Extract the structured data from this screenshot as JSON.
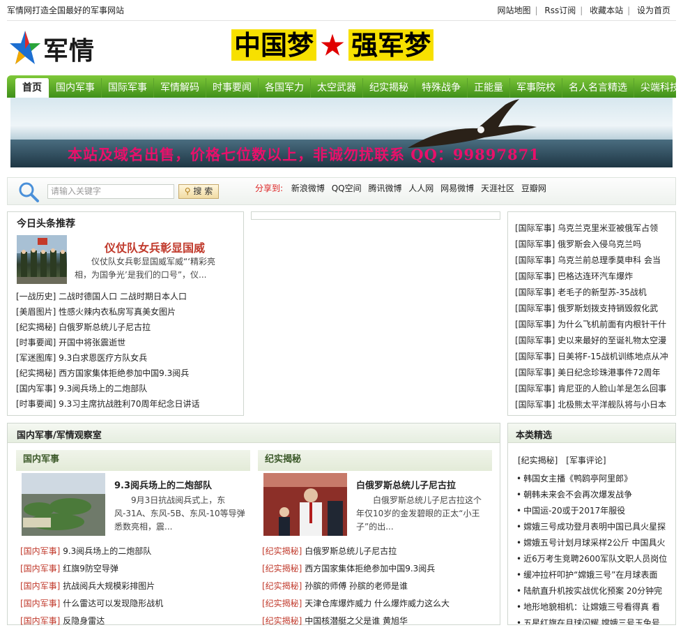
{
  "topbar": {
    "tagline": "军情网打造全国最好的军事网站",
    "links": [
      "网站地图",
      "Rss订阅",
      "收藏本站",
      "设为首页"
    ]
  },
  "header": {
    "logo_text": "军情网",
    "slogan_left": "中国梦",
    "slogan_star": "★",
    "slogan_right": "强军梦"
  },
  "nav": {
    "items": [
      "首页",
      "国内军事",
      "国际军事",
      "军情解码",
      "时事要闻",
      "各国军力",
      "太空武器",
      "纪实揭秘",
      "特殊战争",
      "正能量",
      "军事院校",
      "名人名言精选",
      "尖端科技"
    ]
  },
  "banner": {
    "text": "本站及域名出售，价格七位数以上，非诚勿扰联系 QQ：99897871"
  },
  "search": {
    "placeholder": "请输入关键字",
    "button": "搜 索",
    "share_label": "分享到:",
    "share_links": [
      "新浪微博",
      "QQ空间",
      "腾讯微博",
      "人人网",
      "网易微博",
      "天涯社区",
      "豆瓣网"
    ]
  },
  "top_news": {
    "title": "今日头条推荐",
    "headline": "仪仗队女兵彰显国威",
    "desc": "仪仗队女兵彰显国威军威“‘精彩亮相，为国争光’是我们的口号”，仪...",
    "items": [
      "[一战历史] 二战时德国人口 二战时期日本人口",
      "[美眉图片] 性感火辣内衣私房写真美女图片",
      "[纪实揭秘] 白俄罗斯总统儿子尼古拉",
      "[时事要闻] 开国中将张震逝世",
      "[军迷图库] 9.3白求恩医疗方队女兵",
      "[纪实揭秘] 西方国家集体拒绝参加中国9.3阅兵",
      "[国内军事] 9.3阅兵场上的二炮部队",
      "[时事要闻] 9.3习主席抗战胜利70周年纪念日讲话"
    ]
  },
  "intl_list": {
    "items": [
      "[国际军事] 乌克兰克里米亚被俄军占领",
      "[国际军事] 俄罗斯会入侵乌克兰吗",
      "[国际军事] 乌克兰前总理季莫申科 会当",
      "[国际军事] 巴格达连环汽车爆炸",
      "[国际军事] 老毛子的新型苏-35战机",
      "[国际军事] 俄罗斯划拨支持销毁叙化武",
      "[国际军事] 为什么飞机前面有内根针干什",
      "[国际军事] 史以来最好的至诞礼物太空漫",
      "[国际军事] 日美将F-15战机训练地点从冲",
      "[国际军事] 美日纪念珍珠港事件72周年",
      "[国际军事] 肯尼亚的人脸山羊是怎么回事",
      "[国际军事] 北极熊太平洋舰队将与小日本"
    ]
  },
  "section": {
    "title": "国内军事/军情观察室",
    "col1": {
      "title": "国内军事",
      "feature_title": "9.3阅兵场上的二炮部队",
      "feature_desc": "9月3日抗战阅兵式上，东风-31A、东风-5B、东风-10等导弹悉数亮相，震...",
      "items": [
        {
          "cat": "[国内军事]",
          "text": "9.3阅兵场上的二炮部队"
        },
        {
          "cat": "[国内军事]",
          "text": "红旗9防空导弹"
        },
        {
          "cat": "[国内军事]",
          "text": "抗战阅兵大规模彩排图片"
        },
        {
          "cat": "[国内军事]",
          "text": "什么雷达可以发现隐形战机"
        },
        {
          "cat": "[国内军事]",
          "text": "反隐身雷达"
        }
      ]
    },
    "col2": {
      "title": "纪实揭秘",
      "feature_title": "白俄罗斯总统儿子尼古拉",
      "feature_desc": "白俄罗斯总统儿子尼古拉这个年仅10岁的金发碧眼的正太“小王子”的出...",
      "items": [
        {
          "cat": "[纪实揭秘]",
          "text": "白俄罗斯总统儿子尼古拉"
        },
        {
          "cat": "[纪实揭秘]",
          "text": "西方国家集体拒绝参加中国9.3阅兵"
        },
        {
          "cat": "[纪实揭秘]",
          "text": "孙膑的师傅 孙膑的老师是谁"
        },
        {
          "cat": "[纪实揭秘]",
          "text": "天津仓库爆炸威力 什么爆炸威力这么大"
        },
        {
          "cat": "[纪实揭秘]",
          "text": "中国核潜艇之父是谁 黄旭华"
        }
      ]
    }
  },
  "category_picks": {
    "title": "本类精选",
    "tags": [
      "[纪实揭秘]",
      "[军事评论]"
    ],
    "items": [
      "韩国女主播《鸭鸥亭阿里郎》",
      "朝韩未来会不会再次爆发战争",
      "中国运-20或于2017年服役",
      "嫦娥三号成功登月表明中国已具火星探",
      "嫦娥五号计划月球采样2公斤 中国具火",
      "近6万考生竞聘2600军队文职人员岗位",
      "缓冲拉杆叩护“嫦娥三号”在月球表面",
      "陆航直升机按实战优化预案 20分钟完",
      "地形地貌相机：让嫦娥三号看得真 看",
      "五星红旗在月球闪耀 嫦娥三号玉兔号"
    ]
  },
  "colors": {
    "nav_green": "#3f8f1a",
    "accent_red": "#c0392b",
    "banner_pink": "#e8106a"
  }
}
